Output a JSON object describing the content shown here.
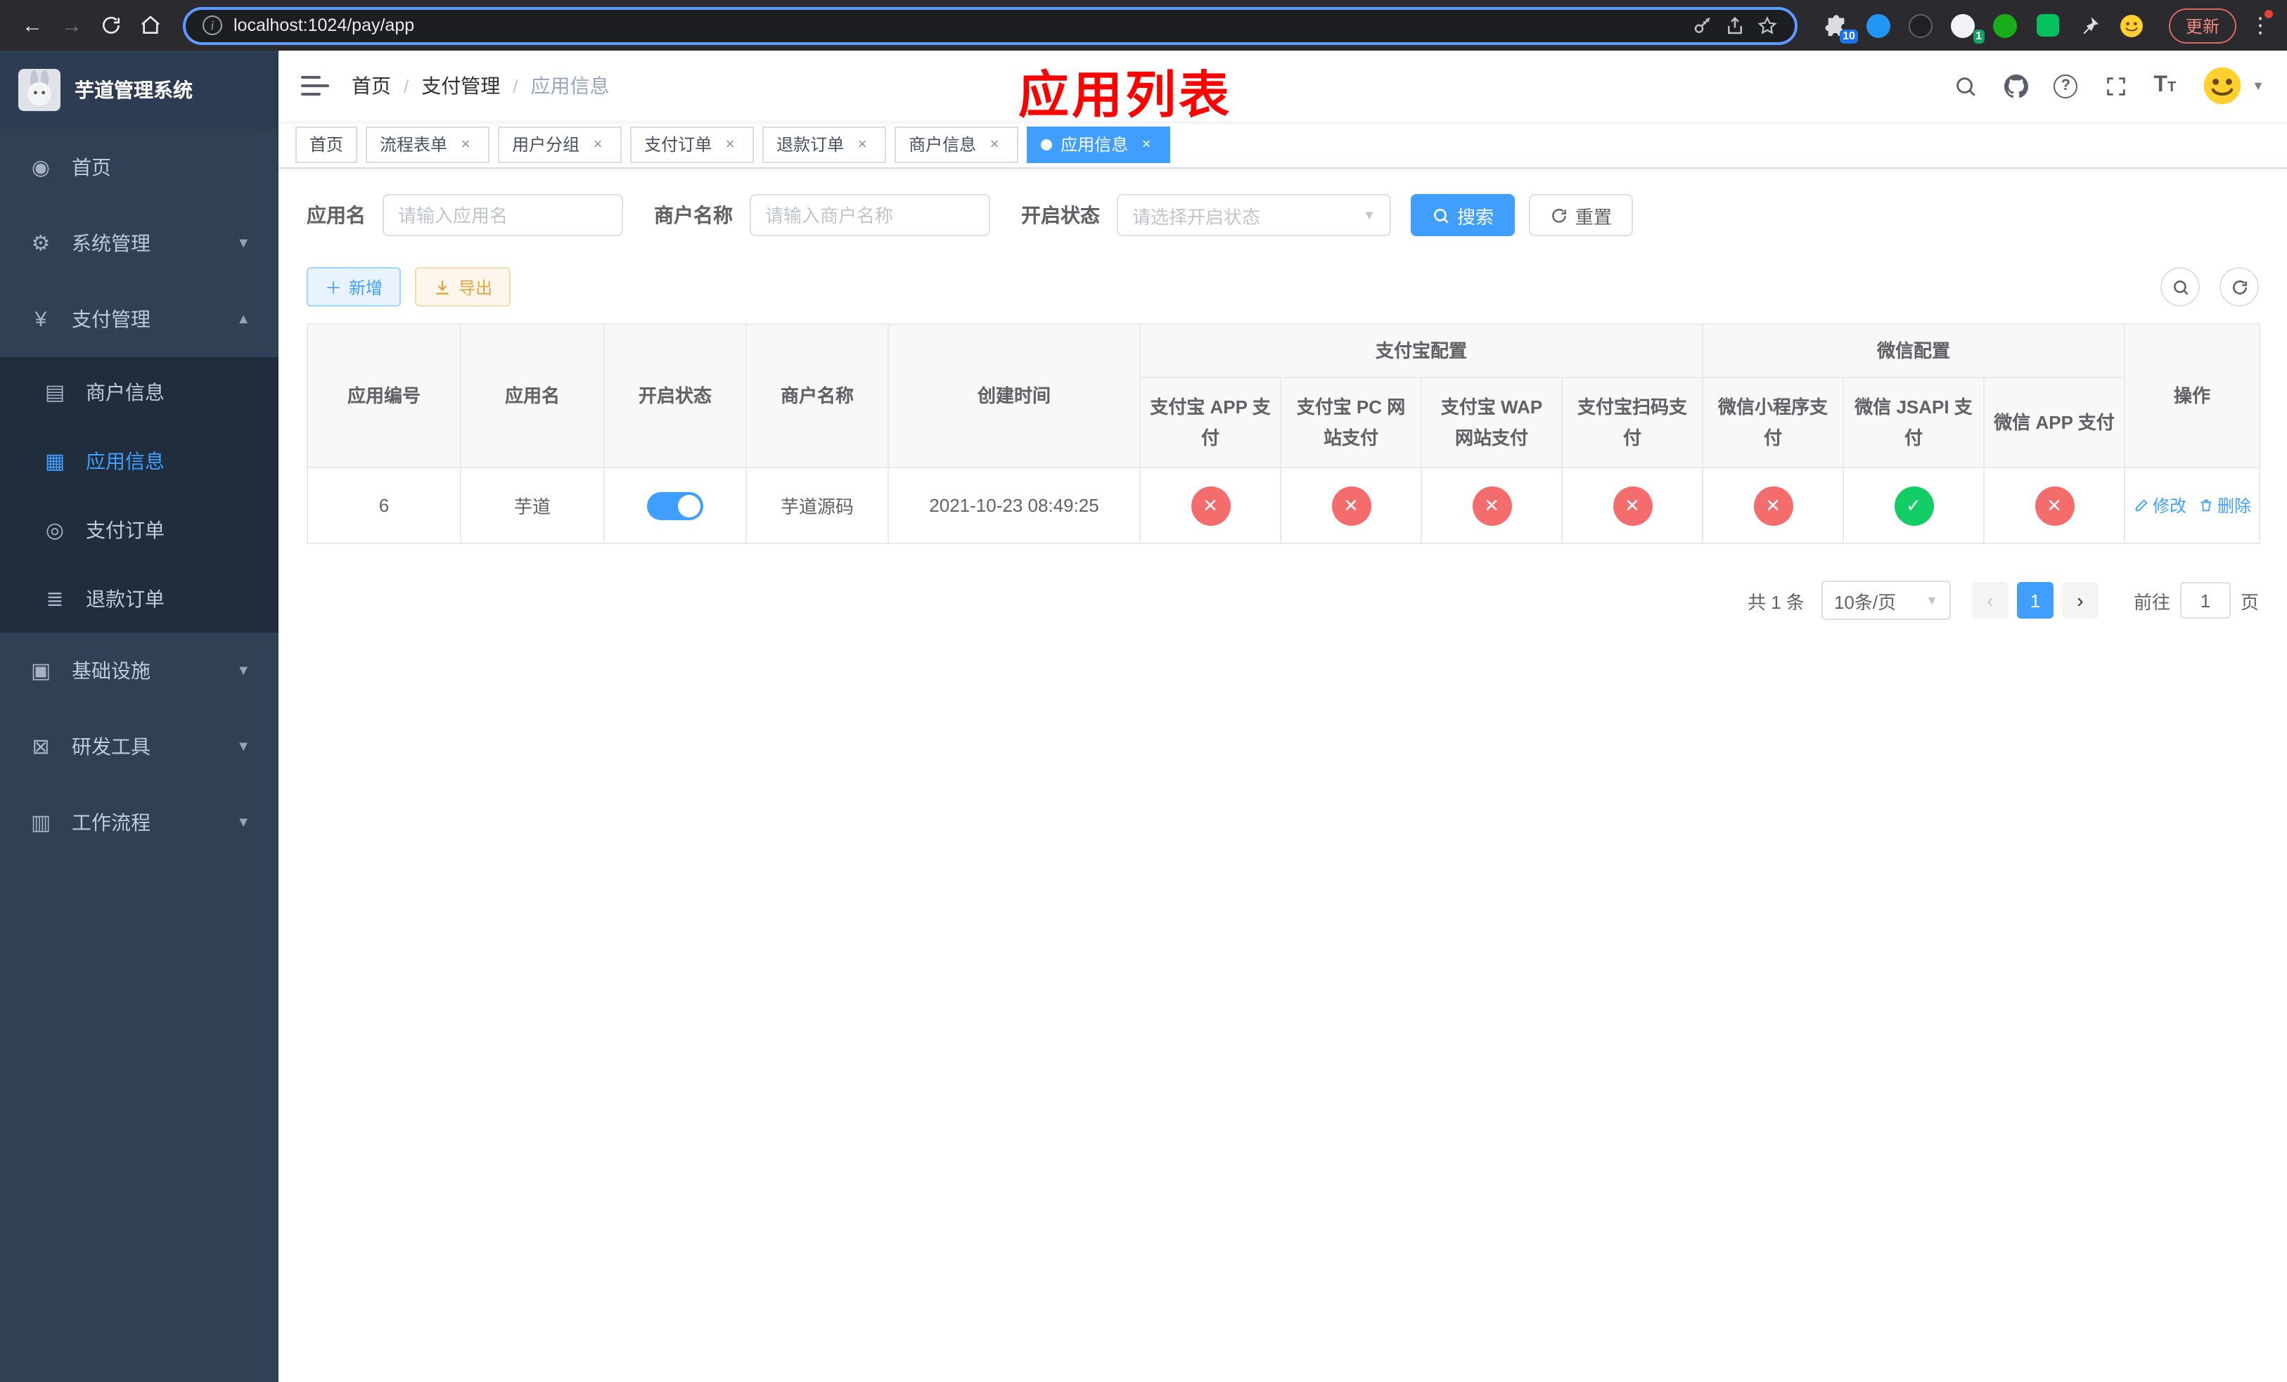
{
  "colors": {
    "accent": "#409eff",
    "danger": "#f56c6c",
    "success": "#13ce66",
    "warning": "#e6a23c",
    "annotation_red": "#fe0000",
    "sidebar_bg": "#304156",
    "submenu_bg": "#1f2d3d"
  },
  "browser": {
    "url": "localhost:1024/pay/app",
    "update_label": "更新",
    "extensions_badge": "10",
    "profile_badge": "1"
  },
  "sidebar": {
    "title": "芋道管理系统",
    "items": [
      {
        "label": "首页",
        "icon": "dashboard-icon",
        "level": "top"
      },
      {
        "label": "系统管理",
        "icon": "gear-icon",
        "level": "top",
        "chevron": "down"
      },
      {
        "label": "支付管理",
        "icon": "yen-icon",
        "level": "top",
        "chevron": "up"
      },
      {
        "label": "商户信息",
        "icon": "merchant-card-icon",
        "level": "sub"
      },
      {
        "label": "应用信息",
        "icon": "app-grid-icon",
        "level": "sub",
        "active": true
      },
      {
        "label": "支付订单",
        "icon": "pay-order-icon",
        "level": "sub"
      },
      {
        "label": "退款订单",
        "icon": "refund-order-icon",
        "level": "sub"
      },
      {
        "label": "基础设施",
        "icon": "infrastructure-icon",
        "level": "top",
        "chevron": "down"
      },
      {
        "label": "研发工具",
        "icon": "devtools-icon",
        "level": "top",
        "chevron": "down"
      },
      {
        "label": "工作流程",
        "icon": "workflow-icon",
        "level": "top",
        "chevron": "down"
      }
    ]
  },
  "header": {
    "breadcrumb": [
      "首页",
      "支付管理",
      "应用信息"
    ],
    "annotation": "应用列表"
  },
  "tabs": [
    {
      "label": "首页",
      "closable": false,
      "active": false
    },
    {
      "label": "流程表单",
      "closable": true,
      "active": false
    },
    {
      "label": "用户分组",
      "closable": true,
      "active": false
    },
    {
      "label": "支付订单",
      "closable": true,
      "active": false
    },
    {
      "label": "退款订单",
      "closable": true,
      "active": false
    },
    {
      "label": "商户信息",
      "closable": true,
      "active": false
    },
    {
      "label": "应用信息",
      "closable": true,
      "active": true
    }
  ],
  "filters": {
    "app_name_label": "应用名",
    "app_name_placeholder": "请输入应用名",
    "merchant_label": "商户名称",
    "merchant_placeholder": "请输入商户名称",
    "status_label": "开启状态",
    "status_placeholder": "请选择开启状态",
    "search_label": "搜索",
    "reset_label": "重置"
  },
  "toolbar": {
    "add_label": "新增",
    "export_label": "导出"
  },
  "table": {
    "columns": [
      "应用编号",
      "应用名",
      "开启状态",
      "商户名称",
      "创建时间"
    ],
    "groups": [
      {
        "label": "支付宝配置",
        "span": 4
      },
      {
        "label": "微信配置",
        "span": 3
      }
    ],
    "sub_columns": [
      "支付宝 APP 支付",
      "支付宝 PC 网站支付",
      "支付宝 WAP 网站支付",
      "支付宝扫码支付",
      "微信小程序支付",
      "微信 JSAPI 支付",
      "微信 APP 支付"
    ],
    "actions_label": "操作",
    "rows": [
      {
        "id": "6",
        "name": "芋道",
        "enabled": true,
        "merchant": "芋道源码",
        "created": "2021-10-23 08:49:25",
        "configs": [
          false,
          false,
          false,
          false,
          false,
          true,
          false
        ],
        "actions": [
          "修改",
          "删除"
        ]
      }
    ]
  },
  "pagination": {
    "total": "共 1 条",
    "page_size": "10条/页",
    "current": "1",
    "goto_label": "前往",
    "goto_value": "1",
    "page_unit": "页"
  }
}
